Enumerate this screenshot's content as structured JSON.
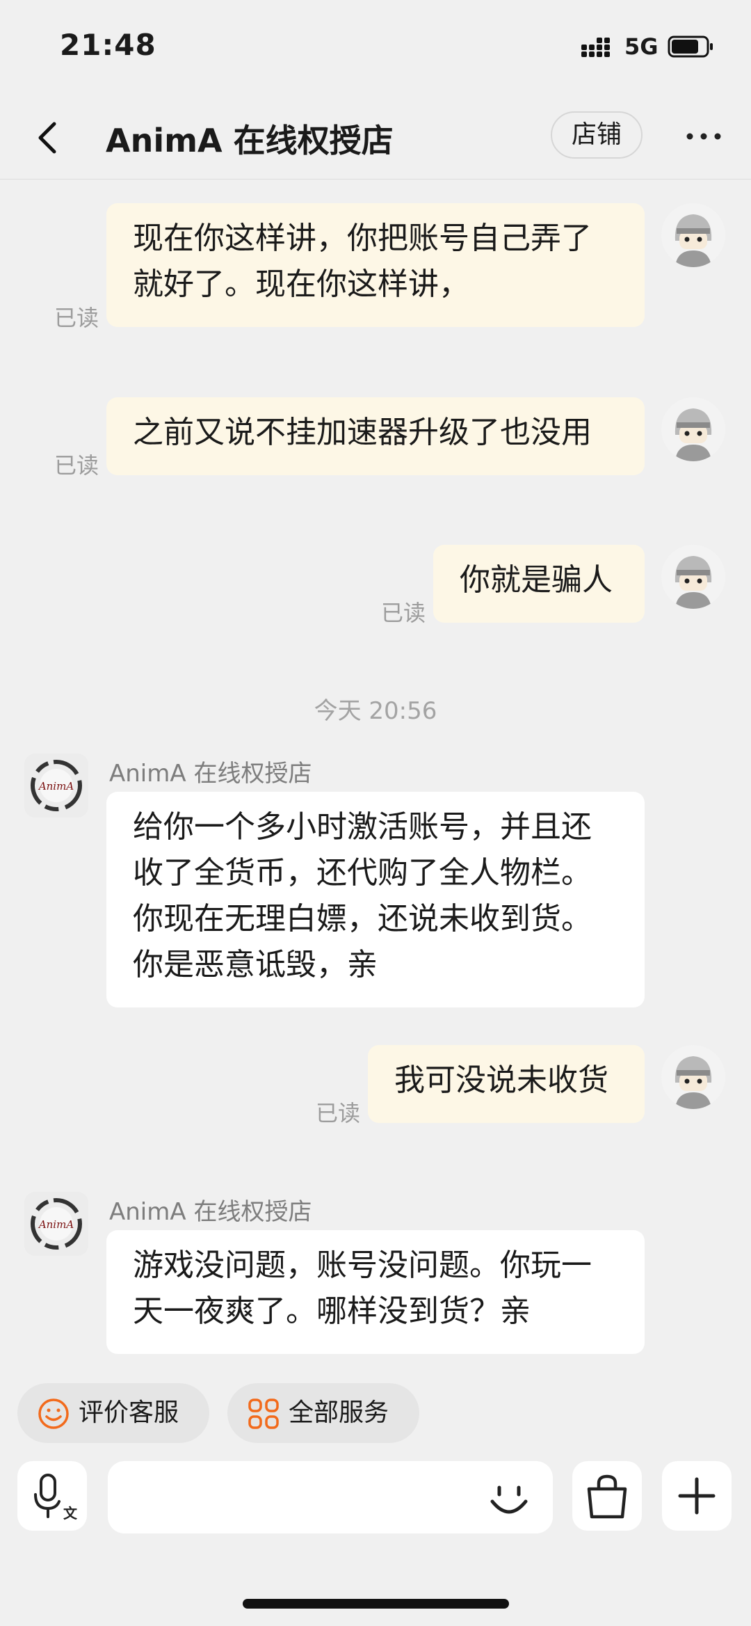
{
  "status_bar": {
    "time": "21:48",
    "network": "5G"
  },
  "nav": {
    "title": "AnimA 在线权授店",
    "shop_button": "店铺"
  },
  "chat": {
    "read_label": "已读",
    "timestamp": "今天 20:56",
    "shop_name": "AnimA 在线权授店",
    "avatar_text": "AnimA",
    "messages": [
      {
        "from": "me",
        "text": "现在你这样讲，你把账号自己弄了\n就好了。现在你这样讲，"
      },
      {
        "from": "me",
        "text": "之前又说不挂加速器升级了也没用"
      },
      {
        "from": "me",
        "text": "你就是骗人"
      },
      {
        "from": "shop",
        "text": "给你一个多小时激活账号，并且还\n收了全货币，还代购了全人物栏。\n你现在无理白嫖，还说未收到货。\n你是恶意诋毁，亲"
      },
      {
        "from": "me",
        "text": "我可没说未收货"
      },
      {
        "from": "shop",
        "text": "游戏没问题，账号没问题。你玩一\n天一夜爽了。哪样没到货？亲"
      }
    ]
  },
  "quick_actions": [
    {
      "label": "评价客服",
      "icon": "smile-icon"
    },
    {
      "label": "全部服务",
      "icon": "services-grid-icon"
    }
  ],
  "input": {
    "placeholder": ""
  },
  "colors": {
    "accent": "#f26a1b",
    "mine_bubble": "#fdf7e6",
    "background": "#f0f0f0"
  }
}
